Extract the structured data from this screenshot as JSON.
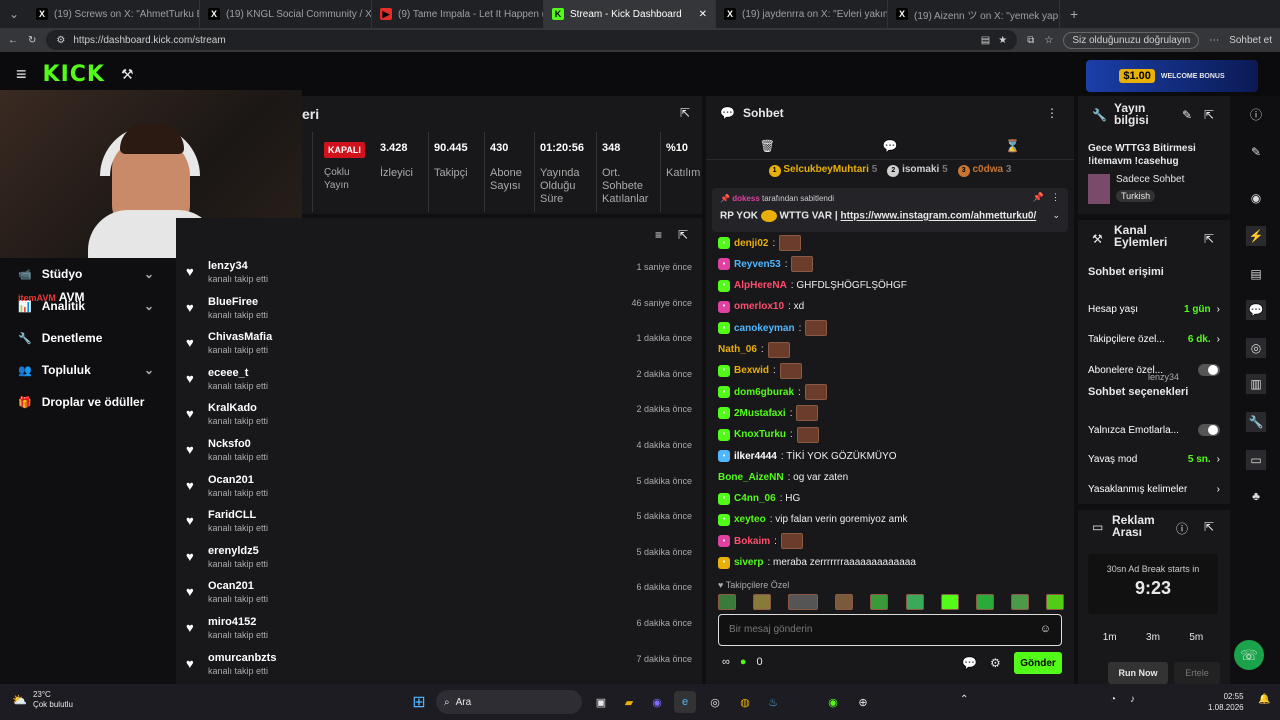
{
  "tabs": [
    {
      "label": "(19) Screws on X: \"AhmetTurku Bü",
      "fav": "X",
      "fc": "#000"
    },
    {
      "label": "(19) KNGL Social Community / X",
      "fav": "X",
      "fc": "#000"
    },
    {
      "label": "(9) Tame Impala - Let It Happen (O",
      "fav": "▶",
      "fc": "#e52d27"
    },
    {
      "label": "Stream - Kick Dashboard",
      "fav": "K",
      "fc": "#53fc18",
      "active": true
    },
    {
      "label": "(19) jaydenrra on X: \"Evleri yakın o",
      "fav": "X",
      "fc": "#000"
    },
    {
      "label": "(19) Aizenn ツ on X: \"yemek yap",
      "fav": "X",
      "fc": "#000"
    }
  ],
  "address": {
    "url": "https://dashboard.kick.com/stream",
    "verify": "Siz olduğunuzu doğrulayın",
    "follow": "Sohbet et"
  },
  "ad_banner": {
    "amount": "$1.00",
    "text": "WELCOME BONUS"
  },
  "sidebar": {
    "items": [
      {
        "label": "Stüdyo",
        "chev": true,
        "icon": "📹"
      },
      {
        "label": "Analitik",
        "chev": true,
        "icon": "📊"
      },
      {
        "label": "Denetleme",
        "icon": "🔧"
      },
      {
        "label": "Topluluk",
        "chev": true,
        "icon": "👥"
      },
      {
        "label": "Droplar ve ödüller",
        "icon": "🎁"
      }
    ],
    "overlay": "AVM",
    "overlay2": "itemAVM"
  },
  "stats": {
    "title": "eri",
    "status": "KAPALI",
    "status_label": "Çoklu Yayın",
    "items": [
      {
        "v": "3.428",
        "l": "İzleyici"
      },
      {
        "v": "90.445",
        "l": "Takipçi"
      },
      {
        "v": "430",
        "l": "Abone Sayısı"
      },
      {
        "v": "01:20:56",
        "l": "Yayında Olduğu Süre"
      },
      {
        "v": "348",
        "l": "Ort. Sohbete Katılanlar"
      },
      {
        "v": "%10",
        "l": "Katılım"
      }
    ]
  },
  "followers": [
    {
      "n": "lenzy34",
      "s": "kanalı takip etti",
      "t": "1 saniye önce"
    },
    {
      "n": "BlueFiree",
      "s": "kanalı takip etti",
      "t": "46 saniye önce"
    },
    {
      "n": "ChivasMafia",
      "s": "kanalı takip etti",
      "t": "1 dakika önce"
    },
    {
      "n": "eceee_t",
      "s": "kanalı takip etti",
      "t": "2 dakika önce"
    },
    {
      "n": "KralKado",
      "s": "kanalı takip etti",
      "t": "2 dakika önce"
    },
    {
      "n": "Ncksfo0",
      "s": "kanalı takip etti",
      "t": "4 dakika önce"
    },
    {
      "n": "Ocan201",
      "s": "kanalı takip etti",
      "t": "5 dakika önce"
    },
    {
      "n": "FaridCLL",
      "s": "kanalı takip etti",
      "t": "5 dakika önce"
    },
    {
      "n": "erenyldz5",
      "s": "kanalı takip etti",
      "t": "5 dakika önce"
    },
    {
      "n": "Ocan201",
      "s": "kanalı takip etti",
      "t": "6 dakika önce"
    },
    {
      "n": "miro4152",
      "s": "kanalı takip etti",
      "t": "6 dakika önce"
    },
    {
      "n": "omurcanbzts",
      "s": "kanalı takip etti",
      "t": "7 dakika önce"
    }
  ],
  "chat": {
    "title": "Sohbet",
    "top": [
      {
        "n": "SelcukbeyMuhtari",
        "c": "5",
        "r": "1",
        "col": "#e8b008"
      },
      {
        "n": "isomaki",
        "c": "5",
        "r": "2",
        "col": "#cfcfcf"
      },
      {
        "n": "c0dwa",
        "c": "3",
        "r": "3",
        "col": "#c87533"
      }
    ],
    "pinned": {
      "by": "dokess",
      "note": "tarafından sabitlendi",
      "text": "RP YOK",
      "text2": "WTTG VAR |",
      "link": "https://www.instagram.com/ahmetturku0/"
    },
    "messages": [
      {
        "u": "denji02",
        "c": "#e8b008",
        "b": "#53fc18",
        "t": "",
        "e": true
      },
      {
        "u": "Reyven53",
        "c": "#4fb6ff",
        "b": "#e040a0",
        "t": "",
        "e": true
      },
      {
        "u": "AlpHereNA",
        "c": "#ff4d6d",
        "b": "#53fc18",
        "t": ": GHFDLŞHÖGFLŞÖHGF"
      },
      {
        "u": "omerlox10",
        "c": "#ff4d6d",
        "b": "#e040a0",
        "t": ": xd"
      },
      {
        "u": "canokeyman",
        "c": "#4fb6ff",
        "b": "#53fc18",
        "t": "",
        "e": true
      },
      {
        "u": "Nath_06",
        "c": "#e8b008",
        "b": "",
        "t": "",
        "e": true
      },
      {
        "u": "Bexwid",
        "c": "#e8b008",
        "b": "#53fc18",
        "t": "",
        "e": true
      },
      {
        "u": "dom6gburak",
        "c": "#53fc18",
        "b": "#53fc18",
        "t": "",
        "e": true
      },
      {
        "u": "2Mustafaxi",
        "c": "#53fc18",
        "b": "#53fc18",
        "t": "",
        "e": true
      },
      {
        "u": "KnoxTurku",
        "c": "#53fc18",
        "b": "#53fc18",
        "t": "",
        "e": true
      },
      {
        "u": "ilker4444",
        "c": "#fff",
        "b": "#4fb6ff",
        "t": ": TİKİ YOK GÖZÜKMÜYO"
      },
      {
        "u": "Bone_AizeNN",
        "c": "#53fc18",
        "b": "",
        "t": ": og var zaten"
      },
      {
        "u": "C4nn_06",
        "c": "#53fc18",
        "b": "#53fc18",
        "t": ": HG"
      },
      {
        "u": "xeyteo",
        "c": "#53fc18",
        "b": "#53fc18",
        "t": ": vip falan verin goremiyoz amk"
      },
      {
        "u": "Bokaim",
        "c": "#ff4d6d",
        "b": "#e040a0",
        "t": "",
        "e": true
      },
      {
        "u": "siverp",
        "c": "#53fc18",
        "b": "#e8b008",
        "t": ": meraba zerrrrrrraaaaaaaaaaaaa"
      }
    ],
    "follower_only": "Takipçilere Özel",
    "placeholder": "Bir mesaj gönderin",
    "points": "0",
    "send": "Gönder"
  },
  "info": {
    "title": "Yayın bilgisi",
    "stream_title": "Gece WTTG3 Bitirmesi !itemavm !casehug",
    "category": "Sadece Sohbet",
    "tag": "Turkish"
  },
  "actions": {
    "title": "Kanal Eylemleri",
    "access": "Sohbet erişimi",
    "rows": [
      {
        "l": "Hesap yaşı",
        "v": "1 gün",
        "arrow": true
      },
      {
        "l": "Takipçilere özel...",
        "v": "6 dk.",
        "arrow": true
      },
      {
        "l": "Abonelere özel...",
        "toggle": true
      },
      {
        "l": "Yalnızca Emotlarla...",
        "toggle": true
      },
      {
        "l": "Yavaş mod",
        "v": "5 sn.",
        "arrow": true
      },
      {
        "l": "Yasaklanmış kelimeler",
        "arrow": true
      }
    ],
    "options": "Sohbet seçenekleri",
    "ghost": "lenzy34"
  },
  "ad": {
    "title": "Reklam Arası",
    "note": "30sn Ad Break starts in",
    "time": "9:23",
    "opts": [
      "1m",
      "3m",
      "5m"
    ],
    "run": "Run Now",
    "cancel": "Ertele"
  },
  "taskbar": {
    "weather": "23°C",
    "weather_sub": "Çok bulutlu",
    "search": "Ara",
    "time": "02:55",
    "date": "1.08.2026"
  },
  "colors": {
    "accent": "#53fc18",
    "panel": "#18181b"
  }
}
